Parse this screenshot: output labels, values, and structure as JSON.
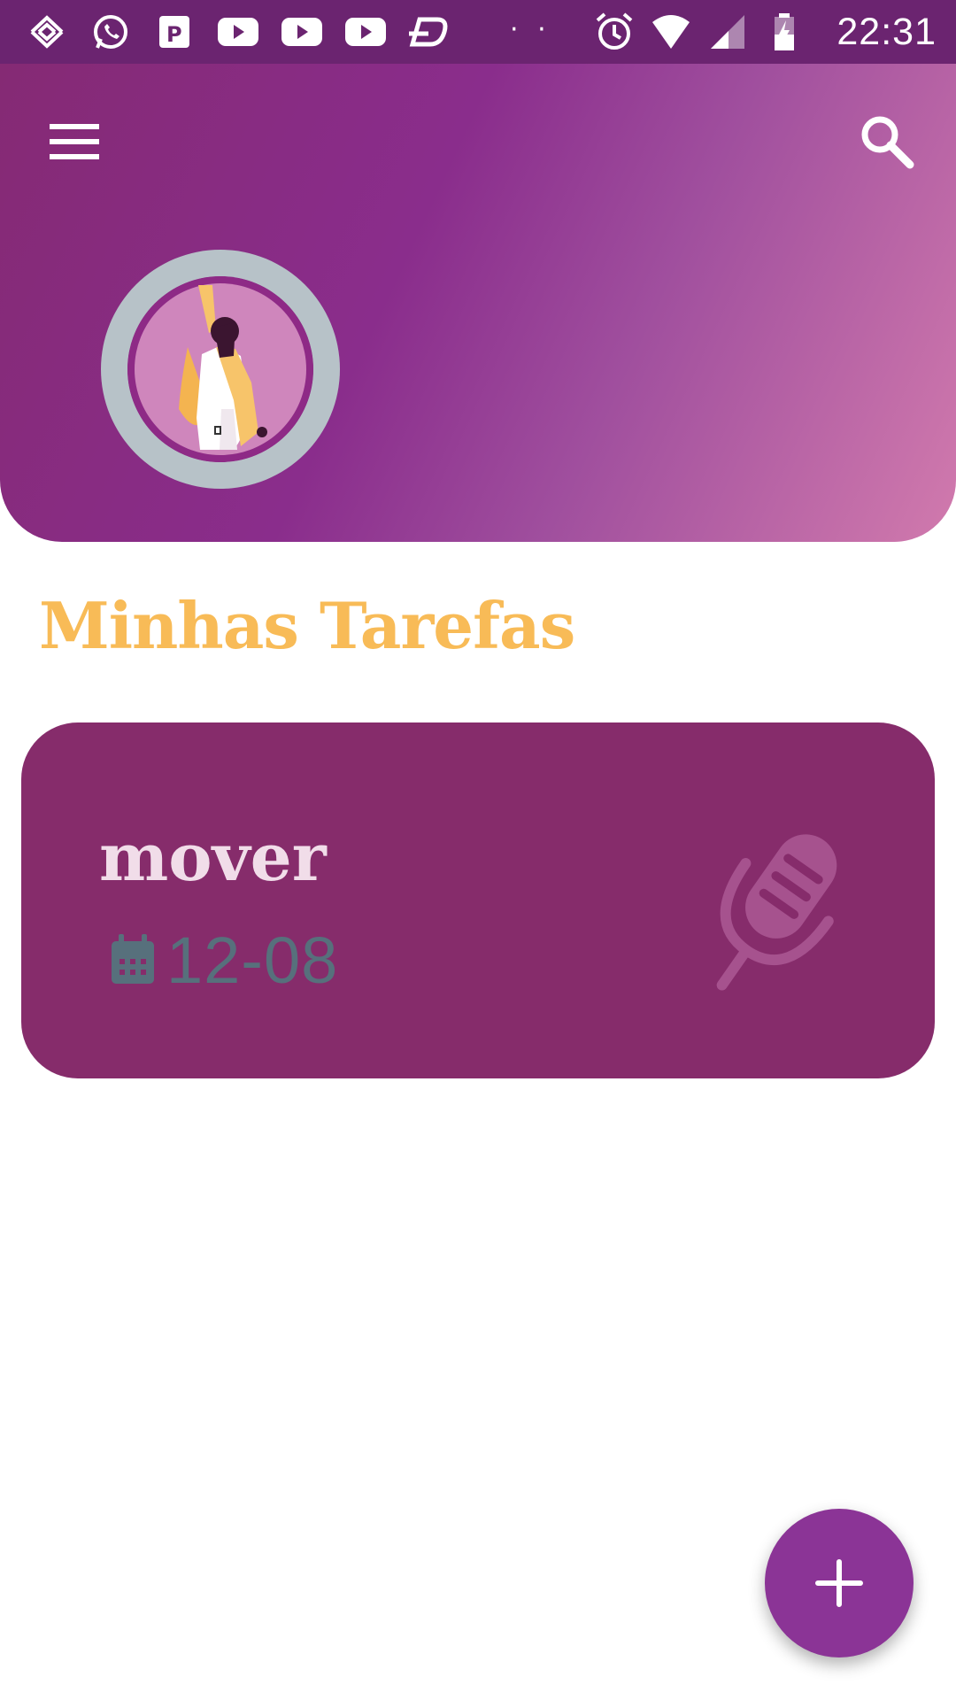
{
  "status_bar": {
    "time": "22:31",
    "left_icons": [
      "banco-do-brasil-icon",
      "whatsapp-icon",
      "parking-app-icon",
      "youtube-icon",
      "youtube-icon",
      "youtube-icon",
      "dz-app-icon"
    ],
    "overflow": "· ·",
    "right_icons": [
      "alarm-icon",
      "wifi-icon",
      "cellular-signal-icon",
      "battery-charging-icon"
    ]
  },
  "header": {
    "menu_icon": "hamburger-menu-icon",
    "search_icon": "search-icon",
    "gradient": [
      "#852a74",
      "#8a2d8c",
      "#a04f9e",
      "#d17aad"
    ],
    "avatar_ring_color": "#b7c2c8"
  },
  "page": {
    "title": "Minhas Tarefas",
    "title_color": "#f8bb57"
  },
  "tasks": [
    {
      "name": "mover",
      "date": "12-08",
      "date_icon": "calendar-icon",
      "mic_icon": "microphone-icon",
      "card_color": "#862c6b"
    }
  ],
  "fab": {
    "icon": "plus-icon",
    "color": "#8b3496"
  }
}
